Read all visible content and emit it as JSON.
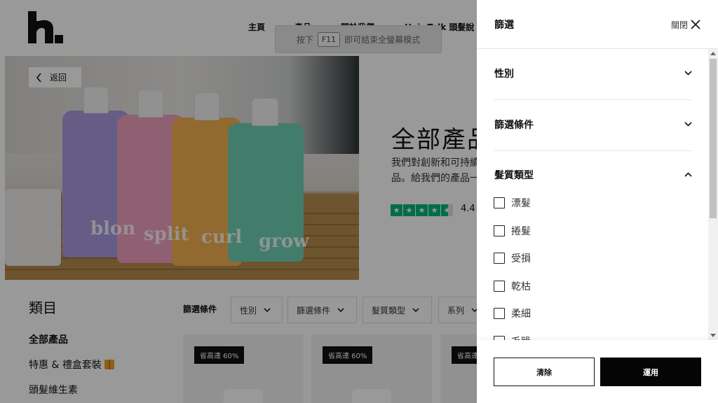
{
  "header": {
    "logo_alt": "h.",
    "nav": [
      "主頁",
      "產品",
      "關於我們",
      "Hair Talk 頭髮說"
    ],
    "fullscreen_hint": {
      "before": "按下",
      "key": "F11",
      "after": "即可結束全螢幕模式"
    }
  },
  "hero": {
    "back_label": "返回",
    "title": "全部產品",
    "description_lines": [
      "我們對創新和可持續",
      "品。給我們的產品一"
    ],
    "rating": "4.4",
    "stars_filled": 4.5,
    "bottle_words": [
      "blon",
      "split",
      "curl",
      "grow"
    ]
  },
  "categories": {
    "heading": "類目",
    "items": [
      "全部產品",
      "特惠 & 禮盒套裝",
      "頭髮維生素"
    ]
  },
  "filter_bar": {
    "label": "篩選條件",
    "chips": [
      "性別",
      "篩選條件",
      "髮質類型",
      "系列"
    ]
  },
  "products": {
    "badge": "省高達 60%"
  },
  "filter_panel": {
    "title": "篩選",
    "close_label": "關閉",
    "sections": [
      {
        "label": "性別",
        "expanded": false
      },
      {
        "label": "篩選條件",
        "expanded": false
      },
      {
        "label": "髮質類型",
        "expanded": true
      }
    ],
    "hair_type_options": [
      "漂髮",
      "捲髮",
      "受損",
      "乾枯",
      "柔細",
      "毛躁"
    ],
    "clear_label": "清除",
    "apply_label": "運用"
  },
  "colors": {
    "overlay": "rgba(0,0,0,0.40)",
    "star_green": "#00b67a",
    "apply_bg": "#050505"
  }
}
